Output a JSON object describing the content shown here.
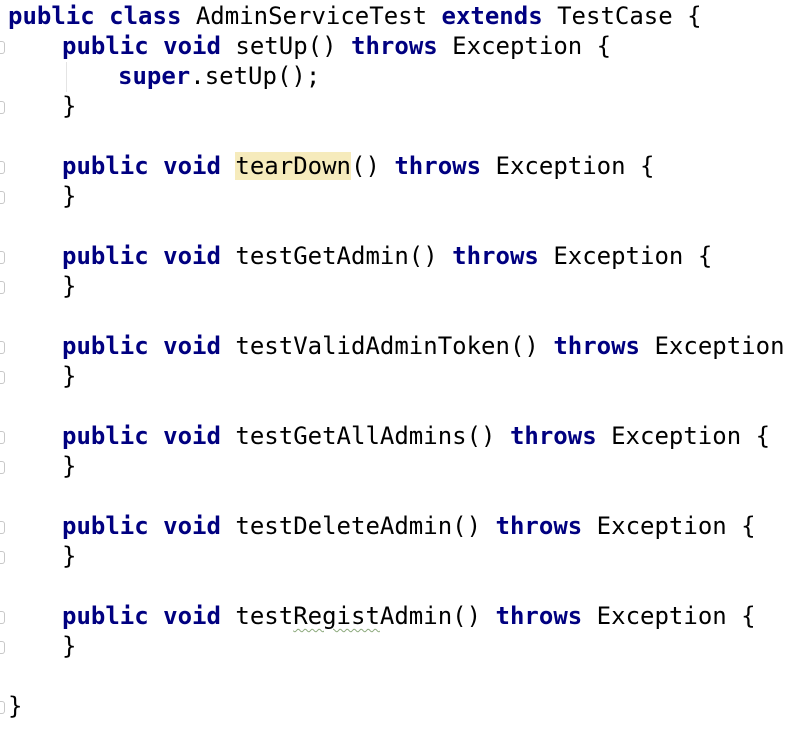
{
  "code": {
    "class_decl": {
      "kw_public": "public",
      "kw_class": "class",
      "name": "AdminServiceTest",
      "kw_extends": "extends",
      "parent": "TestCase",
      "brace": "{"
    },
    "setup": {
      "kw_public": "public",
      "kw_void": "void",
      "name": "setUp",
      "parens": "()",
      "kw_throws": "throws",
      "exception": "Exception",
      "brace": "{"
    },
    "super_call": {
      "kw_super": "super",
      "rest": ".setUp();"
    },
    "close_brace": "}",
    "teardown": {
      "kw_public": "public",
      "kw_void": "void",
      "name": "tearDown",
      "parens": "()",
      "kw_throws": "throws",
      "exception": "Exception",
      "brace": "{"
    },
    "methods": [
      {
        "kw_public": "public",
        "kw_void": "void",
        "name": "testGetAdmin",
        "parens": "()",
        "kw_throws": "throws",
        "exception": "Exception",
        "brace": "{"
      },
      {
        "kw_public": "public",
        "kw_void": "void",
        "name": "testValidAdminToken",
        "parens": "()",
        "kw_throws": "throws",
        "exception": "Exception",
        "brace": "{"
      },
      {
        "kw_public": "public",
        "kw_void": "void",
        "name": "testGetAllAdmins",
        "parens": "()",
        "kw_throws": "throws",
        "exception": "Exception",
        "brace": "{"
      },
      {
        "kw_public": "public",
        "kw_void": "void",
        "name": "testDeleteAdmin",
        "parens": "()",
        "kw_throws": "throws",
        "exception": "Exception",
        "brace": "{"
      }
    ],
    "regist": {
      "kw_public": "public",
      "kw_void": "void",
      "name_a": "test",
      "name_b": "Regist",
      "name_c": "Admin",
      "parens": "()",
      "kw_throws": "throws",
      "exception": "Exception",
      "brace": "{"
    },
    "class_close": "}"
  },
  "colors": {
    "keyword": "#000080",
    "identifier_highlight": "#f6ebbc",
    "typo_underline": "#8aa87a",
    "background": "#ffffff"
  }
}
